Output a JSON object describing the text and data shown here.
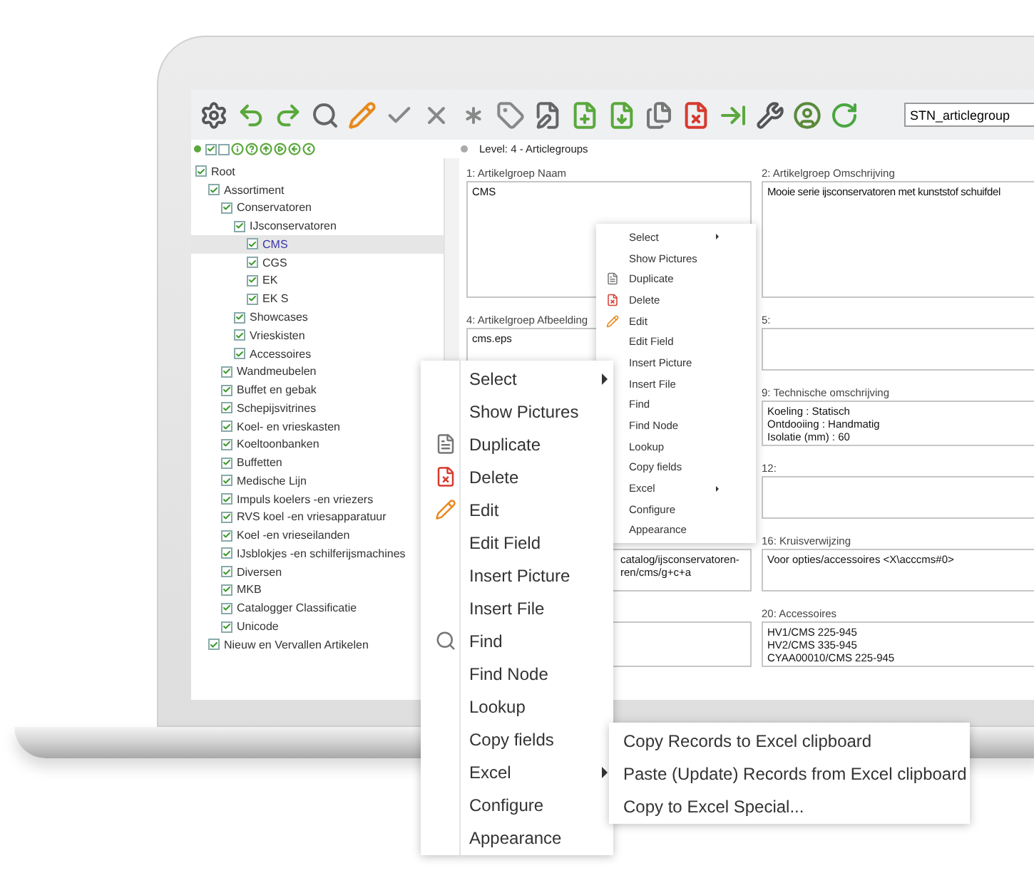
{
  "toolbar": {
    "search_value": "STN_articlegroup"
  },
  "tree_toolbar": {
    "checkboxes": [
      {
        "checked": true
      },
      {
        "checked": false
      }
    ]
  },
  "level_title": "Level: 4 - Articlegroups",
  "tree": [
    {
      "label": "Root",
      "checked": true,
      "selected": false,
      "children": [
        {
          "label": "Assortiment",
          "checked": true,
          "selected": false,
          "children": [
            {
              "label": "Conservatoren",
              "checked": true,
              "selected": false,
              "children": [
                {
                  "label": "IJsconservatoren",
                  "checked": true,
                  "selected": false,
                  "children": [
                    {
                      "label": "CMS",
                      "checked": true,
                      "selected": true
                    },
                    {
                      "label": "CGS",
                      "checked": true,
                      "selected": false
                    },
                    {
                      "label": "EK",
                      "checked": true,
                      "selected": false
                    },
                    {
                      "label": "EK S",
                      "checked": true,
                      "selected": false
                    }
                  ]
                },
                {
                  "label": "Showcases",
                  "checked": true,
                  "selected": false
                },
                {
                  "label": "Vrieskisten",
                  "checked": true,
                  "selected": false
                },
                {
                  "label": "Accessoires",
                  "checked": true,
                  "selected": false
                }
              ]
            },
            {
              "label": "Wandmeubelen",
              "checked": true,
              "selected": false
            },
            {
              "label": "Buffet en gebak",
              "checked": true,
              "selected": false
            },
            {
              "label": "Schepijsvitrines",
              "checked": true,
              "selected": false
            },
            {
              "label": "Koel- en vrieskasten",
              "checked": true,
              "selected": false
            },
            {
              "label": "Koeltoonbanken",
              "checked": true,
              "selected": false
            },
            {
              "label": "Buffetten",
              "checked": true,
              "selected": false
            },
            {
              "label": "Medische Lijn",
              "checked": true,
              "selected": false
            },
            {
              "label": "Impuls koelers -en vriezers",
              "checked": true,
              "selected": false
            },
            {
              "label": "RVS koel -en vriesapparatuur",
              "checked": true,
              "selected": false
            },
            {
              "label": "Koel -en vrieseilanden",
              "checked": true,
              "selected": false
            },
            {
              "label": "IJsblokjes -en schilferijsmachines",
              "checked": true,
              "selected": false
            },
            {
              "label": "Diversen",
              "checked": true,
              "selected": false
            },
            {
              "label": "MKB",
              "checked": true,
              "selected": false
            },
            {
              "label": "Catalogger Classificatie",
              "checked": true,
              "selected": false
            },
            {
              "label": "Unicode",
              "checked": true,
              "selected": false
            }
          ]
        },
        {
          "label": "Nieuw en Vervallen Artikelen",
          "checked": true,
          "selected": false
        }
      ]
    }
  ],
  "form_rows": [
    {
      "left": {
        "label": "1: Artikelgroep Naam",
        "lines": [
          "CMS"
        ]
      },
      "right": {
        "label": "2: Artikelgroep Omschrijving",
        "lines": [
          "Mooie serie ijsconservatoren met kunststof schuifdel"
        ]
      }
    },
    {
      "left": {
        "label": "4: Artikelgroep Afbeelding",
        "lines": [
          "cms.eps"
        ]
      },
      "right": {
        "label": "5:"
      }
    },
    {
      "right": {
        "label": "9: Technische omschrijving",
        "lines": [
          "Koeling : Statisch",
          "Ontdooiing : Handmatig",
          "Isolatie (mm) : 60"
        ]
      }
    },
    {
      "right": {
        "label": "12:"
      }
    },
    {
      "left": {
        "lines": [
          "catalog/ijsconservatoren-",
          "ren/cms/g+c+a"
        ]
      },
      "right": {
        "label": "16: Kruisverwijzing",
        "lines": [
          "Voor opties/accessoires <X\\acccms#0>"
        ]
      }
    },
    {
      "right": {
        "label": "20: Accessoires",
        "lines": [
          "HV1/CMS 225-945",
          "HV2/CMS 335-945",
          "CYAA00010/CMS 225-945"
        ]
      }
    }
  ],
  "small_menu": [
    {
      "label": "Select",
      "kind": "submenu"
    },
    {
      "label": "Show Pictures",
      "kind": "plain"
    },
    {
      "label": "Duplicate",
      "kind": "document"
    },
    {
      "label": "Delete",
      "kind": "document-delete"
    },
    {
      "label": "Edit",
      "kind": "pencil"
    },
    {
      "label": "Edit Field",
      "kind": "plain"
    },
    {
      "label": "Insert Picture",
      "kind": "plain"
    },
    {
      "label": "Insert File",
      "kind": "plain"
    },
    {
      "label": "Find",
      "kind": "plain"
    },
    {
      "label": "Find Node",
      "kind": "plain"
    },
    {
      "label": "Lookup",
      "kind": "plain"
    },
    {
      "label": "Copy fields",
      "kind": "plain"
    },
    {
      "label": "Excel",
      "kind": "submenu"
    },
    {
      "label": "Configure",
      "kind": "plain"
    },
    {
      "label": "Appearance",
      "kind": "plain"
    }
  ],
  "large_menu": [
    {
      "label": "Select",
      "kind": "submenu"
    },
    {
      "label": "Show Pictures",
      "kind": "plain"
    },
    {
      "label": "Duplicate",
      "kind": "document"
    },
    {
      "label": "Delete",
      "kind": "document-delete"
    },
    {
      "label": "Edit",
      "kind": "pencil"
    },
    {
      "label": "Edit Field",
      "kind": "plain"
    },
    {
      "label": "Insert Picture",
      "kind": "plain"
    },
    {
      "label": "Insert File",
      "kind": "plain"
    },
    {
      "label": "Find",
      "kind": "search"
    },
    {
      "label": "Find Node",
      "kind": "plain"
    },
    {
      "label": "Lookup",
      "kind": "plain"
    },
    {
      "label": "Copy fields",
      "kind": "plain"
    },
    {
      "label": "Excel",
      "kind": "submenu"
    },
    {
      "label": "Configure",
      "kind": "plain"
    },
    {
      "label": "Appearance",
      "kind": "plain"
    }
  ],
  "excel_submenu": [
    {
      "label": "Copy Records to Excel clipboard"
    },
    {
      "label": "Paste (Update) Records from Excel clipboard"
    },
    {
      "label": "Copy to Excel Special..."
    }
  ]
}
